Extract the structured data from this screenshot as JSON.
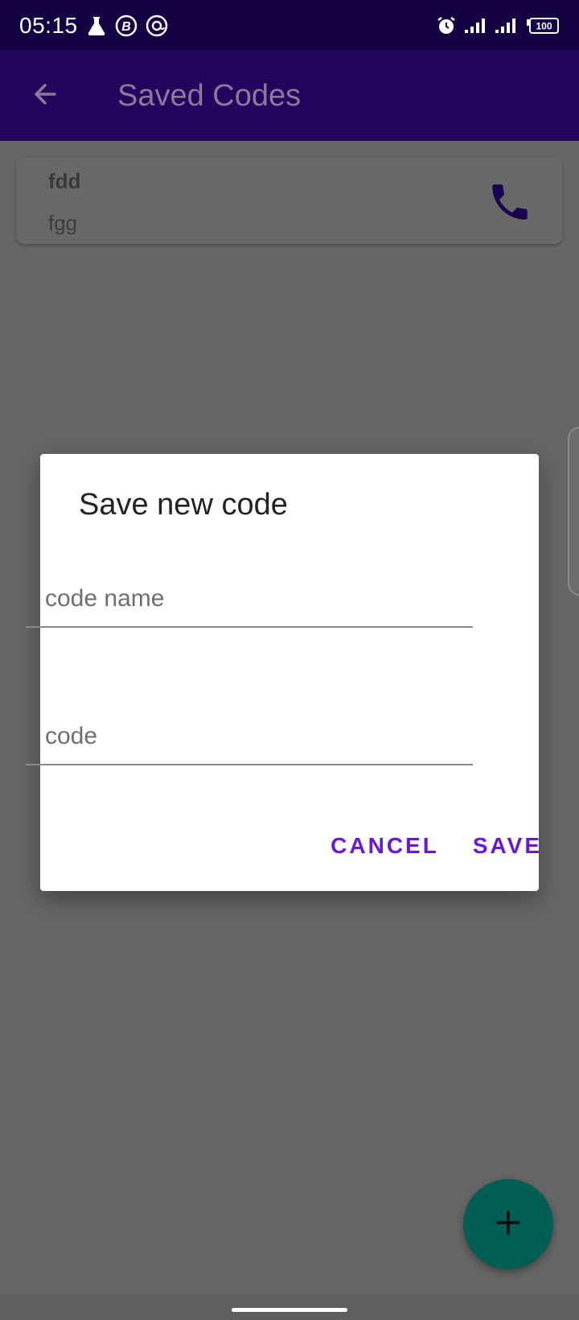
{
  "status_bar": {
    "time": "05:15",
    "battery": "100",
    "icons": [
      "flask-icon",
      "b-circle-icon",
      "at-circle-icon",
      "alarm-icon",
      "signal-icon",
      "signal-icon",
      "battery-icon"
    ]
  },
  "app_bar": {
    "title": "Saved Codes",
    "back_icon": "arrow-left-icon"
  },
  "saved_codes": [
    {
      "name": "fdd",
      "code": "fgg",
      "action_icon": "phone-icon"
    }
  ],
  "dialog": {
    "title": "Save new code",
    "name_placeholder": "code name",
    "code_placeholder": "code",
    "cancel_label": "CANCEL",
    "save_label": "SAVE"
  },
  "fab": {
    "icon": "plus-icon"
  },
  "colors": {
    "status_bar": "#150244",
    "app_bar": "#24045f",
    "accent": "#6a17d9",
    "fab": "#005e55",
    "scrim": "#666666"
  }
}
